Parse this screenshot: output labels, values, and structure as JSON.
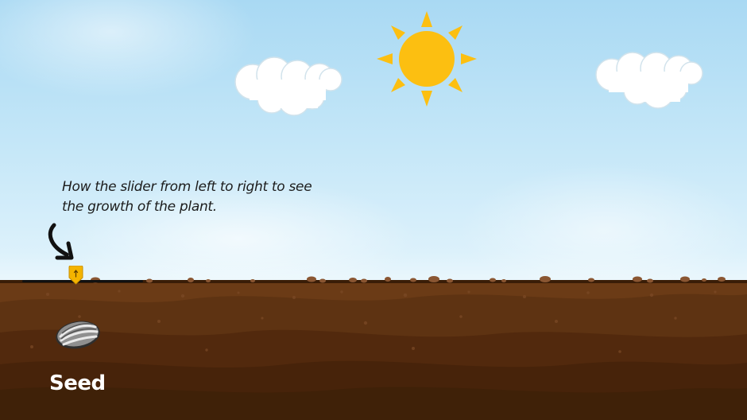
{
  "instruction": {
    "line1": "How the slider from left to right to see",
    "line2": "the growth of the plant."
  },
  "slider": {
    "value": 0,
    "min": 0,
    "max": 1,
    "thumb_icon": "arrow-up-icon"
  },
  "stage": {
    "label": "Seed",
    "icon": "sunflower-seed-icon"
  },
  "colors": {
    "sky": "#c5e7f8",
    "sun": "#fcbf11",
    "soil": "#6b3b16",
    "soil_dark": "#3f2108",
    "thumb": "#f4b400",
    "label_text": "#ffffff",
    "instruction_text": "#1c1c1c"
  },
  "icons": {
    "sun": "sun-icon",
    "cloud": "cloud-icon",
    "pointer": "curved-arrow-icon"
  }
}
